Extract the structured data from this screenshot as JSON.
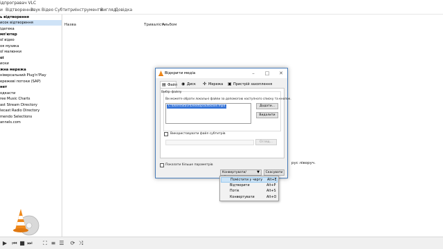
{
  "window": {
    "title": "ідпрогравач VLC"
  },
  "menubar": [
    "и",
    "Відтворення",
    "Звук",
    "Відео",
    "Субтитри",
    "Інструменти",
    "Вигляд",
    "Довідка"
  ],
  "sidebar": {
    "items": [
      {
        "label": "ь відтворення",
        "bold": true
      },
      {
        "label": "исок відтворення",
        "selected": true
      },
      {
        "label": "ідатека"
      },
      {
        "label": "мп'ютер",
        "bold": true
      },
      {
        "label": "ої відео"
      },
      {
        "label": "оя музика"
      },
      {
        "label": "ої малюнки"
      },
      {
        "label": "ої",
        "bold": true
      },
      {
        "label": "иски"
      },
      {
        "label": "жна мережа",
        "bold": true
      },
      {
        "label": "ніверсальний Plug'n'Play"
      },
      {
        "label": "ережеві потоки (SAP)"
      },
      {
        "label": "нет",
        "bold": true
      },
      {
        "label": "одкасти"
      },
      {
        "label": "ree Music Charts"
      },
      {
        "label": "ast Stream Directory"
      },
      {
        "label": "lecast Radio Directory"
      },
      {
        "label": "mendo Selections"
      },
      {
        "label": "annels.com"
      }
    ]
  },
  "playlist": {
    "columns": [
      "Назва",
      "Тривалість",
      "Альбом"
    ],
    "hint": "рус ліворуч."
  },
  "dialog": {
    "title": "Відкрити медіа",
    "tabs": [
      {
        "label": "Файл",
        "icon": "file-icon"
      },
      {
        "label": "Диск",
        "icon": "disc-icon"
      },
      {
        "label": "Мережа",
        "icon": "network-icon"
      },
      {
        "label": "Пристрій захоплення",
        "icon": "capture-device-icon"
      }
    ],
    "file_group_title": "Вибір файлу",
    "file_info": "Ви можете обрати локальні файли за допомогою наступного списку та кнопок.",
    "files": [
      "C:\\Users\\Stavr\\Desktop\\autosave.mp4"
    ],
    "add_button": "Додати...",
    "remove_button": "Видалити",
    "subtitle_checkbox": "Використовувати файл субтитрів",
    "browse_button": "Огляд...",
    "more_options": "Показати більше параметрів",
    "convert_button": "Конвертувати/зберегти",
    "cancel_button": "Скасувати",
    "accent": "#3875d7"
  },
  "dropdown": [
    {
      "label": "Помістити у чергу",
      "shortcut": "Alt+E",
      "highlighted": true
    },
    {
      "label": "Відтворити",
      "shortcut": "Alt+P"
    },
    {
      "label": "Потік",
      "shortcut": "Alt+S"
    },
    {
      "label": "Конвертувати",
      "shortcut": "Alt+O"
    }
  ]
}
